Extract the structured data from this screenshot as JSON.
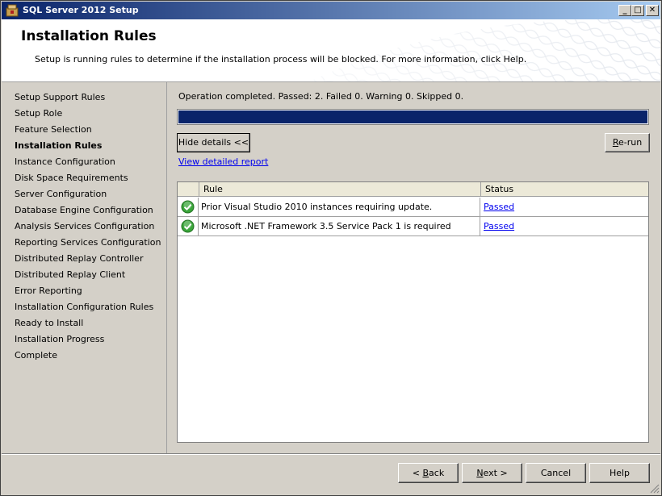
{
  "window": {
    "title": "SQL Server 2012 Setup",
    "minimize_symbol": "_",
    "maximize_symbol": "□",
    "close_symbol": "✕"
  },
  "header": {
    "title": "Installation Rules",
    "description": "Setup is running rules to determine if the installation process will be blocked. For more information, click Help."
  },
  "nav": {
    "items": [
      {
        "label": "Setup Support Rules",
        "active": false
      },
      {
        "label": "Setup Role",
        "active": false
      },
      {
        "label": "Feature Selection",
        "active": false
      },
      {
        "label": "Installation Rules",
        "active": true
      },
      {
        "label": "Instance Configuration",
        "active": false
      },
      {
        "label": "Disk Space Requirements",
        "active": false
      },
      {
        "label": "Server Configuration",
        "active": false
      },
      {
        "label": "Database Engine Configuration",
        "active": false
      },
      {
        "label": "Analysis Services Configuration",
        "active": false
      },
      {
        "label": "Reporting Services Configuration",
        "active": false
      },
      {
        "label": "Distributed Replay Controller",
        "active": false
      },
      {
        "label": "Distributed Replay Client",
        "active": false
      },
      {
        "label": "Error Reporting",
        "active": false
      },
      {
        "label": "Installation Configuration Rules",
        "active": false
      },
      {
        "label": "Ready to Install",
        "active": false
      },
      {
        "label": "Installation Progress",
        "active": false
      },
      {
        "label": "Complete",
        "active": false
      }
    ]
  },
  "main": {
    "status_text": "Operation completed. Passed: 2.   Failed 0.   Warning 0.   Skipped 0.",
    "progress_percent": 100,
    "hide_details_label": "Hide details <<",
    "rerun_label_accel": "R",
    "rerun_label_rest": "e-run",
    "detailed_report_link": "View detailed report",
    "grid": {
      "columns": [
        "Rule",
        "Status"
      ],
      "rows": [
        {
          "icon": "check-circle-icon",
          "rule": "Prior Visual Studio 2010 instances requiring update.",
          "status": "Passed"
        },
        {
          "icon": "check-circle-icon",
          "rule": "Microsoft .NET Framework 3.5 Service Pack 1 is required",
          "status": "Passed"
        }
      ]
    }
  },
  "footer": {
    "back_prefix": "< ",
    "back_accel": "B",
    "back_rest": "ack",
    "next_accel": "N",
    "next_rest": "ext >",
    "cancel_label": "Cancel",
    "help_label": "Help"
  },
  "colors": {
    "title_bar_start": "#0a246a",
    "title_bar_end": "#a6caf0",
    "progress_fill": "#0a246a",
    "window_bg": "#d4d0c8",
    "link": "#0000ee",
    "passed_icon": "#3aa53a"
  }
}
